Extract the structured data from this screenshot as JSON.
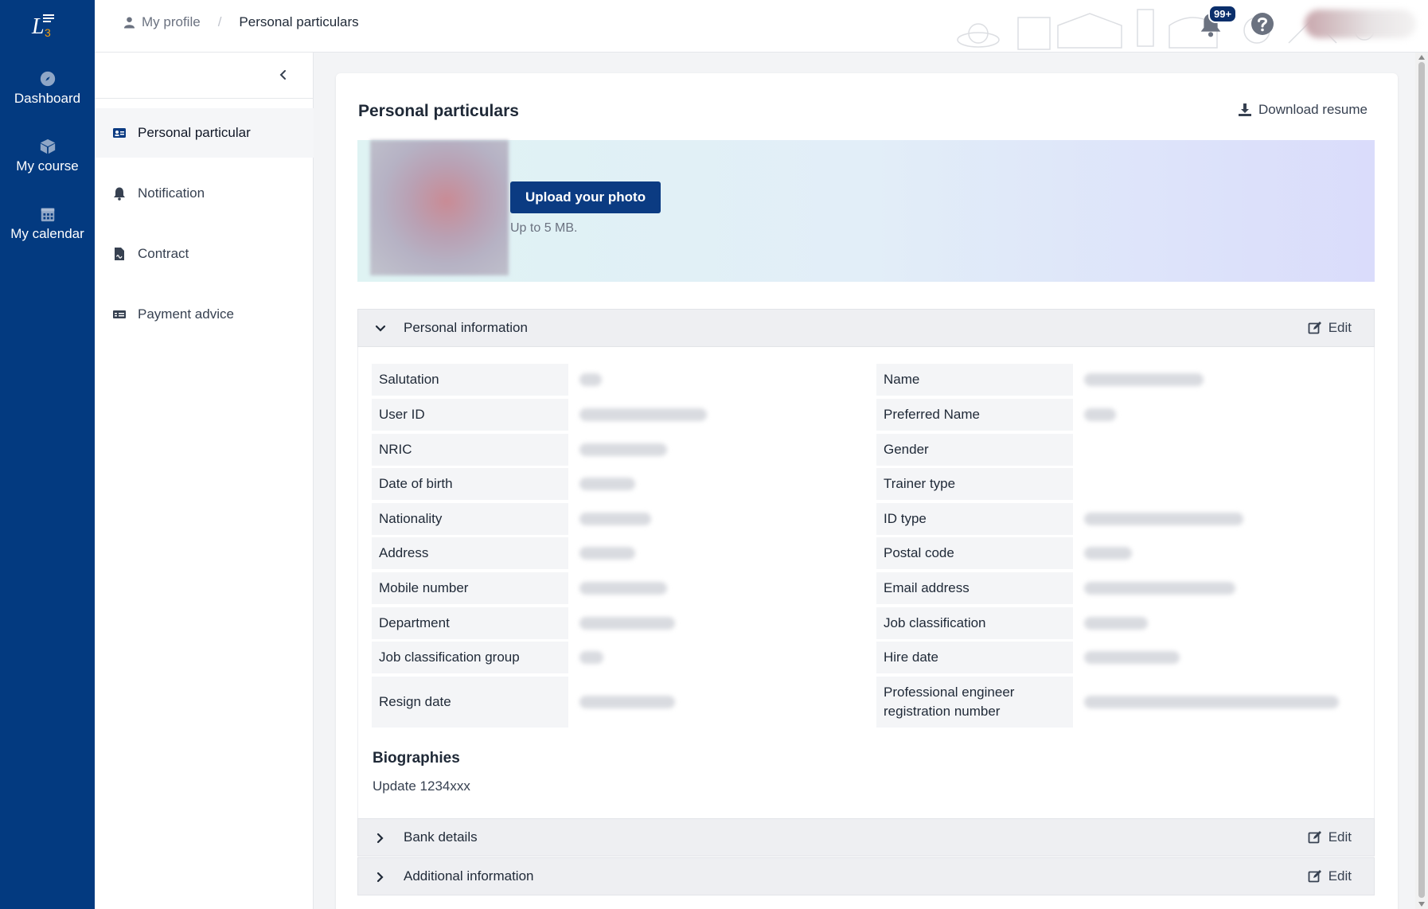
{
  "rail": {
    "logo_text": "L3",
    "items": [
      {
        "label": "Dashboard",
        "icon": "compass-icon"
      },
      {
        "label": "My course",
        "icon": "cube-icon"
      },
      {
        "label": "My calendar",
        "icon": "calendar-icon"
      }
    ]
  },
  "header": {
    "breadcrumb": {
      "parent": "My profile",
      "separator": "/",
      "current": "Personal particulars"
    },
    "notification_count": "99+"
  },
  "subnav": {
    "items": [
      {
        "label": "Personal particular",
        "icon": "id-card-icon",
        "active": true
      },
      {
        "label": "Notification",
        "icon": "bell-icon",
        "active": false
      },
      {
        "label": "Contract",
        "icon": "document-icon",
        "active": false
      },
      {
        "label": "Payment advice",
        "icon": "money-icon",
        "active": false
      }
    ]
  },
  "main": {
    "title": "Personal particulars",
    "download_label": "Download resume",
    "upload_button": "Upload your photo",
    "upload_note": "Up to 5 MB.",
    "sections": {
      "personal": {
        "title": "Personal information",
        "edit_label": "Edit"
      },
      "bank": {
        "title": "Bank details",
        "edit_label": "Edit"
      },
      "additional": {
        "title": "Additional information",
        "edit_label": "Edit"
      }
    },
    "fields_left": [
      "Salutation",
      "User ID",
      "NRIC",
      "Date of birth",
      "Nationality",
      "Address",
      "Mobile number",
      "Department",
      "Job classification group",
      "Resign date"
    ],
    "fields_right": [
      "Name",
      "Preferred Name",
      "Gender",
      "Trainer type",
      "ID type",
      "Postal code",
      "Email address",
      "Job classification",
      "Hire date",
      "Professional engineer registration number"
    ],
    "biographies_title": "Biographies",
    "biographies_text": "Update 1234xxx"
  },
  "colors": {
    "rail_bg": "#033a80",
    "button_bg": "#0b3b82",
    "badge_bg": "#0b2f6b"
  }
}
